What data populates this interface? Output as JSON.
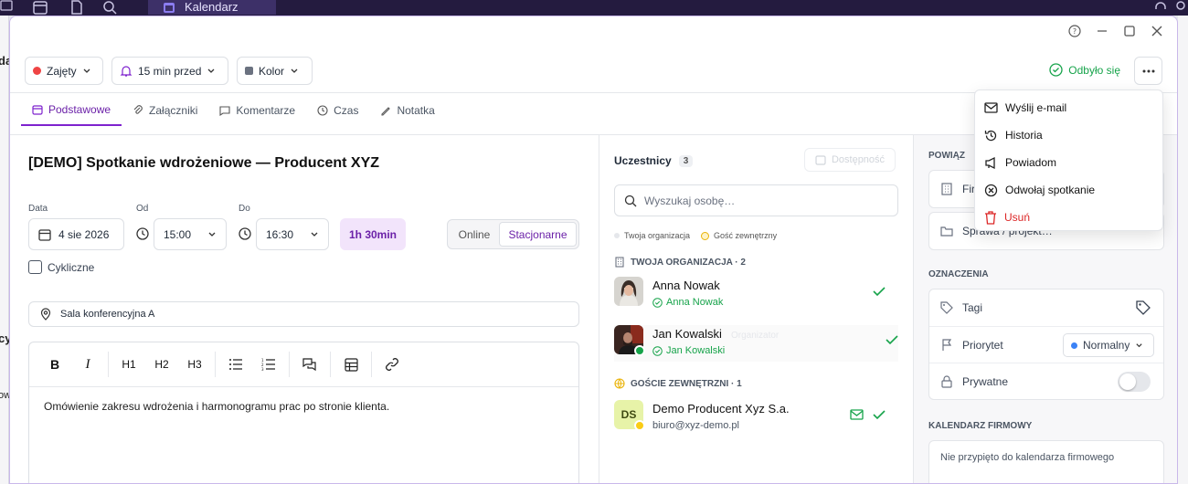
{
  "appbar": {
    "tab_label": "Kalendarz"
  },
  "background": {
    "left_frag_1": "da",
    "left_frag_2": "cy",
    "left_frag_3": "ow"
  },
  "toolbar": {
    "status_label": "Zajęty",
    "status_color": "#ef4444",
    "reminder_label": "15 min przed",
    "color_label": "Kolor",
    "color_value": "#6b7280",
    "done_label": "Odbyło się"
  },
  "tabs": [
    {
      "label": "Podstawowe",
      "icon": "calendar-icon",
      "active": true
    },
    {
      "label": "Załączniki",
      "icon": "paperclip-icon"
    },
    {
      "label": "Komentarze",
      "icon": "comment-icon"
    },
    {
      "label": "Czas",
      "icon": "clock-icon"
    },
    {
      "label": "Notatka",
      "icon": "note-icon"
    }
  ],
  "event": {
    "title": "[DEMO] Spotkanie wdrożeniowe — Producent XYZ",
    "date_label": "Data",
    "date_value": "4 sie 2026",
    "from_label": "Od",
    "from_value": "15:00",
    "to_label": "Do",
    "to_value": "16:30",
    "duration": "1h 30min",
    "mode_online": "Online",
    "mode_onsite": "Stacjonarne",
    "recurring_label": "Cykliczne",
    "location": "Sala konferencyjna A",
    "description": "Omówienie zakresu wdrożenia i harmonogramu prac po stronie klienta.",
    "editor_buttons": [
      "B",
      "I",
      "H1",
      "H2",
      "H3"
    ]
  },
  "participants": {
    "heading": "Uczestnicy",
    "count": "3",
    "availability_label": "Dostępność",
    "search_placeholder": "Wyszukaj osobę…",
    "legend_org": "Twoja organizacja",
    "legend_ext": "Gość zewnętrzny",
    "section_org": "TWOJA ORGANIZACJA · 2",
    "section_ext": "GOŚCIE ZEWNĘTRZNI · 1",
    "people": [
      {
        "name": "Anna Nowak",
        "sub": "Anna Nowak"
      },
      {
        "name": "Jan Kowalski",
        "sub": "Jan Kowalski",
        "role": "Organizator"
      },
      {
        "name": "Demo Producent Xyz S.a.",
        "sub": "biuro@xyz-demo.pl",
        "initials": "DS"
      }
    ]
  },
  "sidebar": {
    "related_heading": "POWIĄZ",
    "company_label": "Firm",
    "cases_label": "Sprawa / projekt…",
    "marks_heading": "OZNACZENIA",
    "tags_label": "Tagi",
    "priority_label": "Priorytet",
    "priority_value": "Normalny",
    "private_label": "Prywatne",
    "company_cal_heading": "KALENDARZ FIRMOWY",
    "company_cal_text": "Nie przypięto do kalendarza firmowego"
  },
  "menu": {
    "items": [
      {
        "label": "Wyślij e-mail",
        "icon": "mail-icon"
      },
      {
        "label": "Historia",
        "icon": "history-icon"
      },
      {
        "label": "Powiadom",
        "icon": "megaphone-icon"
      },
      {
        "label": "Odwołaj spotkanie",
        "icon": "cancel-circle-icon"
      },
      {
        "label": "Usuń",
        "icon": "trash-icon"
      }
    ]
  }
}
